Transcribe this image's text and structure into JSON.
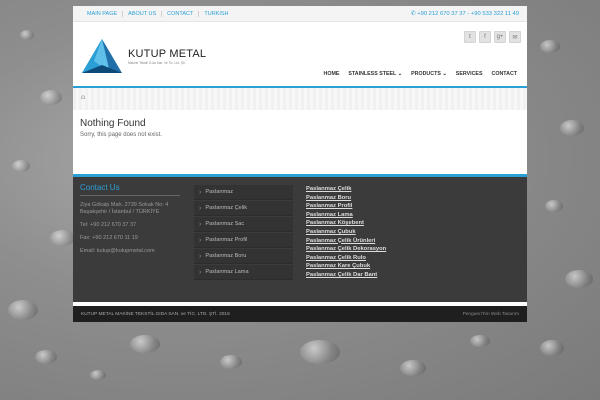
{
  "topbar": {
    "links": [
      "MAIN PAGE",
      "ABOUT US",
      "CONTACT",
      "TURKISH"
    ],
    "phone": "+90 212 670 37 37 - +90 533 322 11 49"
  },
  "header": {
    "logo_name": "KUTUP METAL",
    "logo_sub": "Makine Tekstil G.da San. Ve Tic. Ltd. Şti.",
    "social_icons": [
      "twitter-icon",
      "facebook-icon",
      "google-plus-icon",
      "mail-icon"
    ],
    "nav": [
      "HOME",
      "STAINLESS STEEL",
      "PRODUCTS",
      "SERVICES",
      "CONTACT"
    ]
  },
  "breadcrumb": {
    "home_icon": "home-icon"
  },
  "main": {
    "title": "Nothing Found",
    "message": "Sorry, this page does not exist."
  },
  "footer": {
    "contact_title": "Contact Us",
    "address": "Ziya Gökalp Mah. 2739 Sokak No: 4 Başakşehir / İstanbul / TÜRKİYE",
    "tel": "Tel: +90 212 670 37 37",
    "fax": "Fax: +90 212 670 11 19",
    "email": "Email: kutup@kutupmetal.com",
    "menu": [
      "Paslanmaz",
      "Paslanmaz Çelik",
      "Paslanmaz Sac",
      "Paslanmaz Profil",
      "Paslanmaz Boru",
      "Paslanmaz Lama"
    ],
    "links": [
      "Paslanmaz Çelik",
      "Paslanmaz Boru",
      "Paslanmaz Profil",
      "Paslanmaz Lama",
      "Paslanmaz Köşebent",
      "Paslanmaz Çubuk",
      "Paslanmaz Çelik Ürünleri",
      "Paslanmaz Çelik Dekorasyon",
      "Paslanmaz Çelik Rulo",
      "Paslanmaz Kare Çubuk",
      "Paslanmaz Çelik Dar Bant"
    ]
  },
  "bottom": {
    "copyright": "KUTUP METAL MAKİNE TEKSTİL GIDA SAN. ve TİC. LTD. ŞTİ. 2015",
    "credit": "PenguenTim Web Tasarım"
  },
  "colors": {
    "accent": "#2a9fd6",
    "footer_bg": "#3b3b3b"
  }
}
